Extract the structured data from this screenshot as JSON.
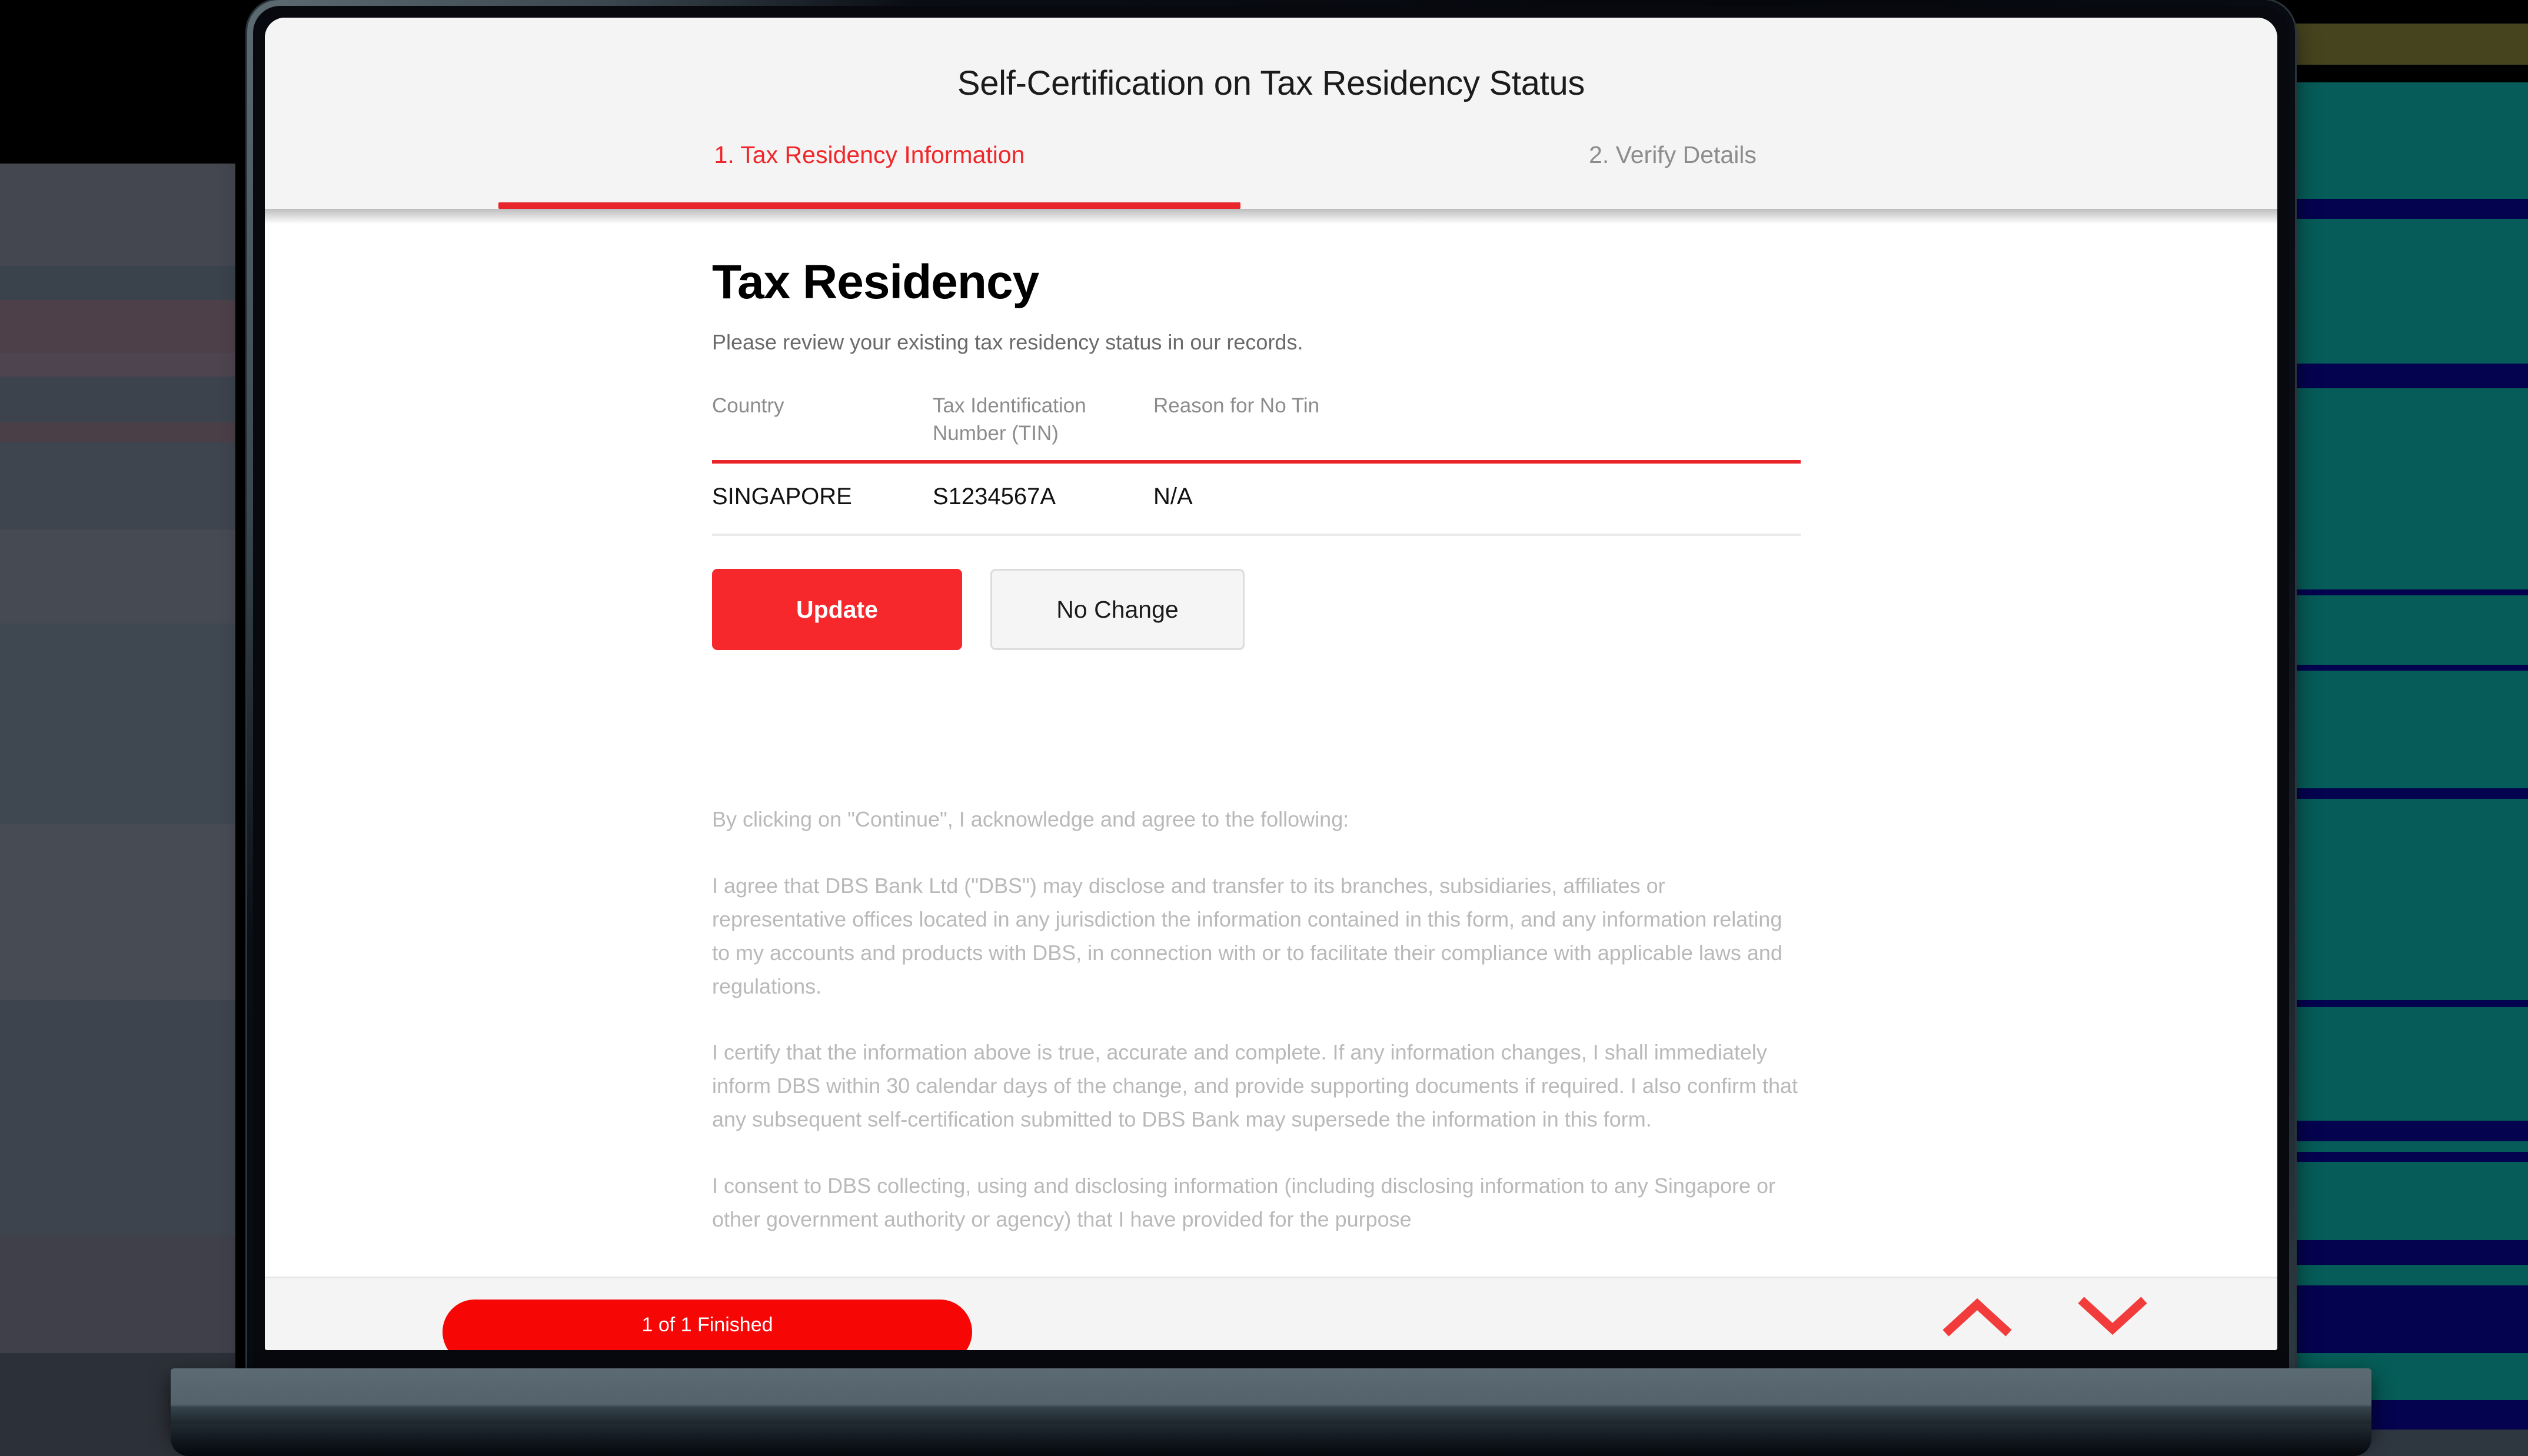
{
  "app": {
    "title": "Self-Certification on Tax Residency Status"
  },
  "tabs": [
    {
      "label": "1. Tax Residency Information",
      "state": "active"
    },
    {
      "label": "2. Verify Details",
      "state": "inactive"
    }
  ],
  "page": {
    "heading": "Tax Residency",
    "subheading": "Please review your existing tax residency status in our records."
  },
  "table": {
    "headers": [
      "Country",
      "Tax Identification Number (TIN)",
      "Reason for No Tin"
    ],
    "rows": [
      {
        "country": "SINGAPORE",
        "tin": "S1234567A",
        "reason": "N/A"
      }
    ]
  },
  "actions": {
    "update_label": "Update",
    "no_change_label": "No Change"
  },
  "legal": {
    "intro": "By clicking on \"Continue\", I acknowledge and agree to the following:",
    "p1": "I agree that DBS Bank Ltd (\"DBS\") may disclose and transfer to its branches, subsidiaries, affiliates or representative offices located in any jurisdiction the information contained in this form, and any information relating to my accounts and products with DBS, in connection with or to facilitate their compliance with applicable laws and regulations.",
    "p2": "I certify that the information above is true, accurate and complete. If any information changes, I shall immediately inform DBS within 30 calendar days of the change, and provide supporting documents if required. I also confirm that any subsequent self-certification submitted to DBS Bank may supersede the information in this form.",
    "p3": "I consent to DBS collecting, using and disclosing information (including disclosing information to any Singapore or other government authority or agency) that I have provided for the purpose"
  },
  "bottom_bar": {
    "progress_label": "1 of 1 Finished",
    "scroll_up_icon": "chevron-up-icon",
    "scroll_down_icon": "chevron-down-icon"
  },
  "colors": {
    "brand_red": "#e8252a",
    "button_red": "#f6282c",
    "progress_red": "#f70606",
    "muted_text": "#8c8c8c",
    "legal_text": "#b9b9b9"
  }
}
